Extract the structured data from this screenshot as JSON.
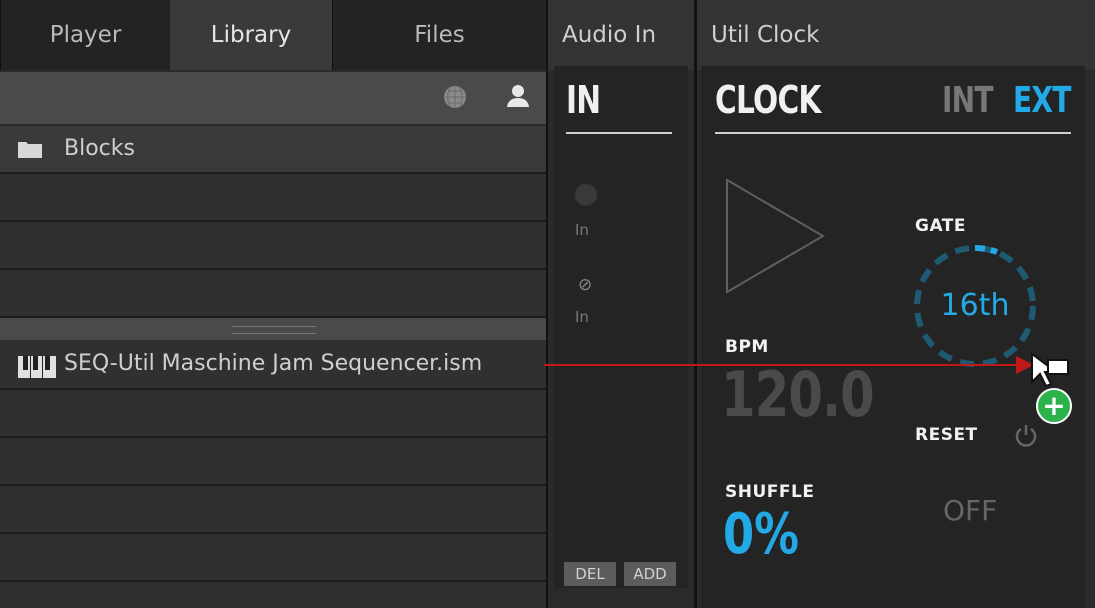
{
  "library_panel": {
    "tabs": [
      {
        "label": "Player"
      },
      {
        "label": "Library"
      },
      {
        "label": "Files"
      }
    ],
    "rows": [
      {
        "label": "Blocks"
      },
      {
        "label": "SEQ-Util Maschine Jam Sequencer.ism"
      }
    ]
  },
  "audio_in_module": {
    "header": "Audio In",
    "title": "IN",
    "input1_label": "In",
    "input2_label": "In",
    "del_label": "DEL",
    "add_label": "ADD"
  },
  "clock_module": {
    "header": "Util Clock",
    "title": "CLOCK",
    "mode_int": "INT",
    "mode_ext": "EXT",
    "active_mode": "EXT",
    "gate_label": "GATE",
    "gate_value": "16th",
    "bpm_label": "BPM",
    "bpm_value": "120.0",
    "reset_label": "RESET",
    "shuffle_label": "SHUFFLE",
    "shuffle_value": "0%",
    "off_label": "OFF"
  },
  "colors": {
    "accent_blue": "#22a9e6",
    "drag_line_red": "#c01818",
    "add_badge_green": "#2bb24a"
  }
}
